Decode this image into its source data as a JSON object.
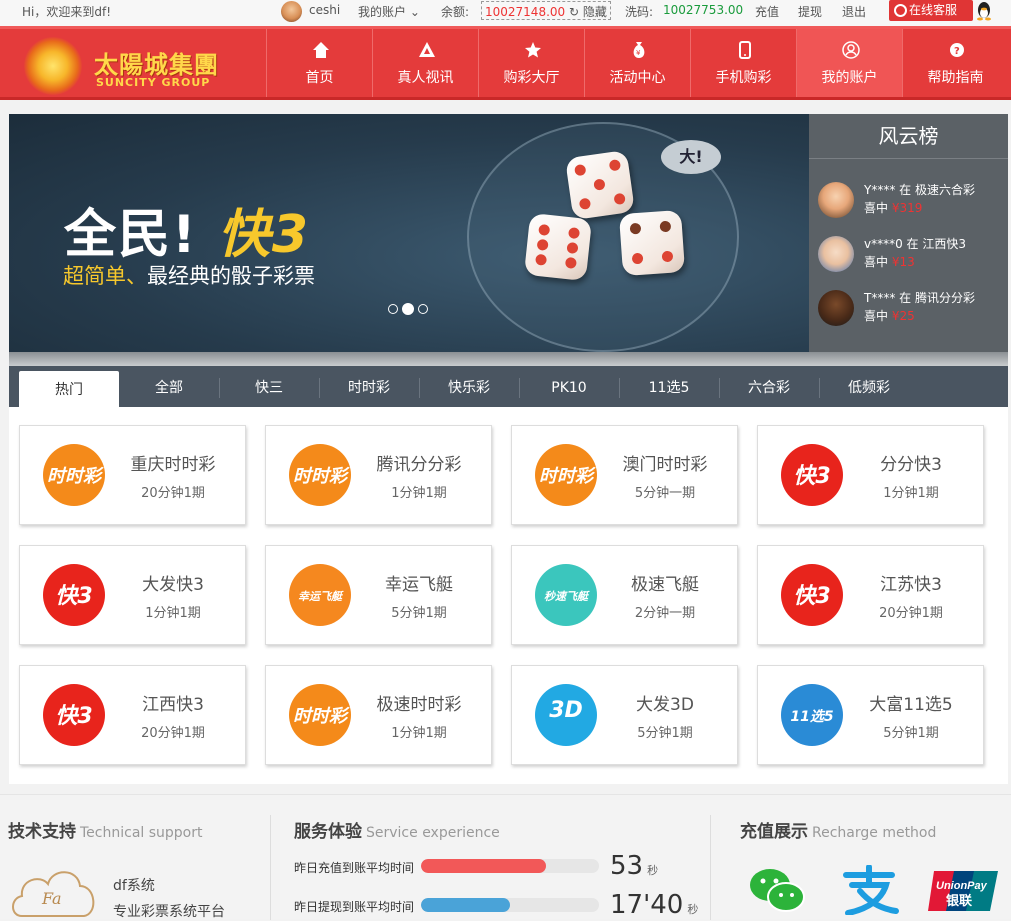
{
  "topbar": {
    "greeting": "Hi，欢迎来到df!",
    "username": "ceshi",
    "account_menu": "我的账户 ⌄",
    "balance_label": "余额:",
    "balance": "10027148.00",
    "hide_label": "隐藏",
    "wash_label": "洗码:",
    "wash_value": "10027753.00",
    "recharge": "充值",
    "withdraw": "提现",
    "logout": "退出",
    "service": "在线客服"
  },
  "logo": {
    "cn": "太陽城集團",
    "en": "SUNCITY GROUP"
  },
  "nav": [
    {
      "label": "首页",
      "icon": "home-icon"
    },
    {
      "label": "真人视讯",
      "icon": "triangle-icon"
    },
    {
      "label": "购彩大厅",
      "icon": "star-icon"
    },
    {
      "label": "活动中心",
      "icon": "money-bag-icon"
    },
    {
      "label": "手机购彩",
      "icon": "mobile-icon"
    },
    {
      "label": "我的账户",
      "icon": "user-icon"
    },
    {
      "label": "帮助指南",
      "icon": "help-icon"
    }
  ],
  "banner": {
    "headline_a": "全民!",
    "headline_b": "快3",
    "sub_a": "超简单、",
    "sub_b": "最经典的骰子彩票",
    "bubble": "大!",
    "active_dot": 1
  },
  "rank": {
    "title": "风云榜",
    "entries": [
      {
        "line1": "Y**** 在 极速六合彩",
        "won": "喜中",
        "amount": "¥319"
      },
      {
        "line1": "v****0 在 江西快3",
        "won": "喜中",
        "amount": "¥13"
      },
      {
        "line1": "T**** 在 腾讯分分彩",
        "won": "喜中",
        "amount": "¥25"
      }
    ]
  },
  "tabs": [
    "热门",
    "全部",
    "快三",
    "时时彩",
    "快乐彩",
    "PK10",
    "11选5",
    "六合彩",
    "低频彩"
  ],
  "games": [
    {
      "name": "重庆时时彩",
      "freq": "20分钟1期",
      "icon": "ssc",
      "icon_text": "时时彩"
    },
    {
      "name": "腾讯分分彩",
      "freq": "1分钟1期",
      "icon": "ssc",
      "icon_text": "时时彩"
    },
    {
      "name": "澳门时时彩",
      "freq": "5分钟一期",
      "icon": "ssc",
      "icon_text": "时时彩"
    },
    {
      "name": "分分快3",
      "freq": "1分钟1期",
      "icon": "k3",
      "icon_text": "快3"
    },
    {
      "name": "大发快3",
      "freq": "1分钟1期",
      "icon": "k3",
      "icon_text": "快3"
    },
    {
      "name": "幸运飞艇",
      "freq": "5分钟1期",
      "icon": "fly1",
      "icon_text": "幸运飞艇"
    },
    {
      "name": "极速飞艇",
      "freq": "2分钟一期",
      "icon": "fly2",
      "icon_text": "秒速飞艇"
    },
    {
      "name": "江苏快3",
      "freq": "20分钟1期",
      "icon": "k3",
      "icon_text": "快3"
    },
    {
      "name": "江西快3",
      "freq": "20分钟1期",
      "icon": "k3",
      "icon_text": "快3"
    },
    {
      "name": "极速时时彩",
      "freq": "1分钟1期",
      "icon": "ssc",
      "icon_text": "时时彩"
    },
    {
      "name": "大发3D",
      "freq": "5分钟1期",
      "icon": "d3",
      "icon_text": "3D"
    },
    {
      "name": "大富11选5",
      "freq": "5分钟1期",
      "icon": "x5",
      "icon_text": "11选5"
    }
  ],
  "footer": {
    "tech_title": "技术支持",
    "tech_en": "Technical support",
    "cloud_text": "Fa",
    "system": "df系统",
    "system_desc": "专业彩票系统平台",
    "service_title": "服务体验",
    "service_en": "Service experience",
    "deposit_label": "昨日充值到账平均时间",
    "deposit_value": "53",
    "deposit_unit": "秒",
    "deposit_level": 0.7,
    "withdraw_label": "昨日提现到账平均时间",
    "withdraw_value": "17'40",
    "withdraw_unit": "秒",
    "withdraw_level": 0.5,
    "pay_title": "充值展示",
    "pay_en": "Recharge method",
    "unionpay_en": "UnionPay",
    "unionpay_cn": "银联"
  },
  "colors": {
    "brand_red": "#e43b3b",
    "deposit_bar": "#f25858",
    "withdraw_bar": "#4aa3d8",
    "gold": "#f7c82c"
  }
}
